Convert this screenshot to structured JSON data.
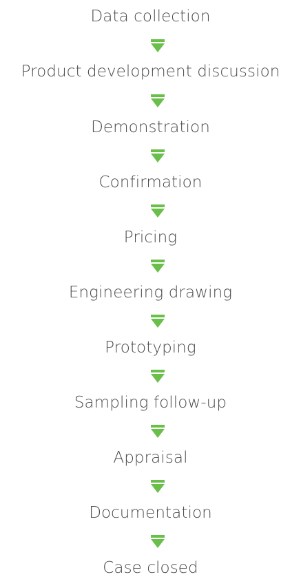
{
  "steps": [
    {
      "label": "Data collection"
    },
    {
      "label": "Product development discussion"
    },
    {
      "label": "Demonstration"
    },
    {
      "label": "Confirmation"
    },
    {
      "label": "Pricing"
    },
    {
      "label": "Engineering drawing"
    },
    {
      "label": "Prototyping"
    },
    {
      "label": "Sampling follow-up"
    },
    {
      "label": "Appraisal"
    },
    {
      "label": "Documentation"
    },
    {
      "label": "Case closed"
    }
  ],
  "arrow_icon": "down-arrow-icon",
  "colors": {
    "text": "#4a4a4a",
    "arrow": "#6abf4b"
  }
}
